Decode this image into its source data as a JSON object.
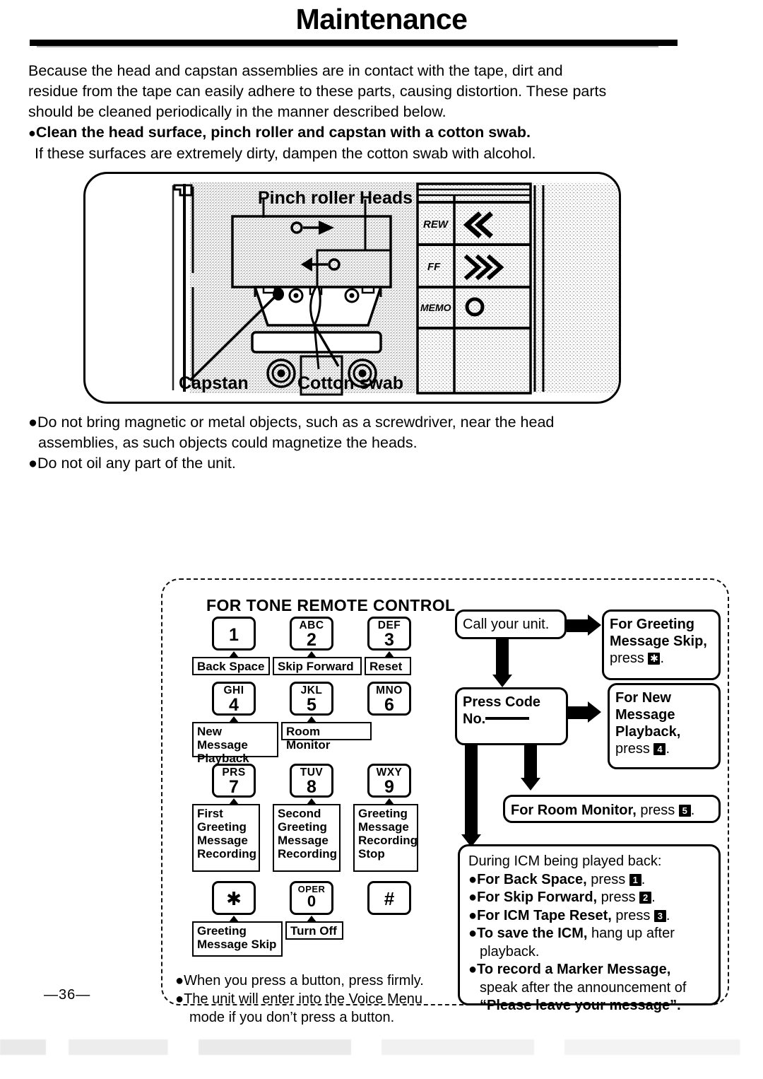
{
  "page": {
    "title": "Maintenance",
    "page_number": "—36—"
  },
  "intro": {
    "line1": "Because the head and capstan assemblies are in contact with the tape, dirt and",
    "line2": "residue from the tape can easily adhere to these parts, causing distortion. These parts",
    "line3": "should be cleaned periodically in the manner described below.",
    "bullet": "Clean the head surface, pinch roller and capstan with a cotton swab.",
    "subnote": "If these surfaces are extremely dirty, dampen the cotton swab with alcohol."
  },
  "illustration": {
    "labels": {
      "pinch_roller": "Pinch roller",
      "heads": "Heads",
      "capstan": "Capstan",
      "cotton_swab": "Cotton swab"
    },
    "panel_buttons": [
      "REW",
      "FF",
      "MEMO"
    ]
  },
  "warnings": {
    "w1_line1": "Do not bring magnetic or metal objects, such as a screwdriver, near the head",
    "w1_line2": "assemblies, as such objects could magnetize the heads.",
    "w2": "Do not oil any part of the unit."
  },
  "remote": {
    "title": "FOR TONE REMOTE CONTROL",
    "keys": [
      {
        "letters": "",
        "digit": "1"
      },
      {
        "letters": "ABC",
        "digit": "2"
      },
      {
        "letters": "DEF",
        "digit": "3"
      },
      {
        "letters": "GHI",
        "digit": "4"
      },
      {
        "letters": "JKL",
        "digit": "5"
      },
      {
        "letters": "MNO",
        "digit": "6"
      },
      {
        "letters": "PRS",
        "digit": "7"
      },
      {
        "letters": "TUV",
        "digit": "8"
      },
      {
        "letters": "WXY",
        "digit": "9"
      },
      {
        "letters": "",
        "digit": "✱"
      },
      {
        "letters": "OPER",
        "digit": "0"
      },
      {
        "letters": "",
        "digit": "#"
      }
    ],
    "functions": {
      "k1": "Back Space",
      "k2": "Skip Forward",
      "k3": "Reset",
      "k4_l1": "New Message",
      "k4_l2": "Playback",
      "k5": "Room Monitor",
      "k7_l1": "First",
      "k7_l2": "Greeting",
      "k7_l3": "Message",
      "k7_l4": "Recording",
      "k8_l1": "Second",
      "k8_l2": "Greeting",
      "k8_l3": "Message",
      "k8_l4": "Recording",
      "k9_l1": "Greeting",
      "k9_l2": "Message",
      "k9_l3": "Recording",
      "k9_l4": "Stop",
      "kstar_l1": "Greeting",
      "kstar_l2": "Message Skip",
      "k0": "Turn Off"
    },
    "tips": {
      "t1": "●When you press a button, press firmly.",
      "t2": "●The unit will enter into the Voice Menu",
      "t2b": "mode if you don’t press a button."
    }
  },
  "flow": {
    "call_unit": "Call your unit.",
    "press_code_l1": "Press Code",
    "press_code_l2": "No.",
    "greeting_skip_l1": "For Greeting",
    "greeting_skip_l2": "Message Skip,",
    "greeting_skip_press": "press",
    "greeting_skip_key": "✱",
    "new_msg_l1": "For New",
    "new_msg_l2": "Message",
    "new_msg_l3": "Playback,",
    "new_msg_press": "press",
    "new_msg_key": "4",
    "room_monitor_label": "For Room Monitor,",
    "room_monitor_press": "press",
    "room_monitor_key": "5"
  },
  "icm": {
    "heading": "During ICM being played back:",
    "i1_bold": "●For Back Space,",
    "i1_rest": "press",
    "i1_key": "1",
    "i2_bold": "●For Skip Forward,",
    "i2_rest": "press",
    "i2_key": "2",
    "i3_bold": "●For ICM Tape Reset,",
    "i3_rest": "press",
    "i3_key": "3",
    "i4_bold": "●To save the ICM,",
    "i4_rest": "hang up after",
    "i4_cont": "playback.",
    "i5_bold": "●To record a Marker Message,",
    "i5_cont": "speak after the announcement of",
    "i5_quote": "“Please leave your message”."
  }
}
